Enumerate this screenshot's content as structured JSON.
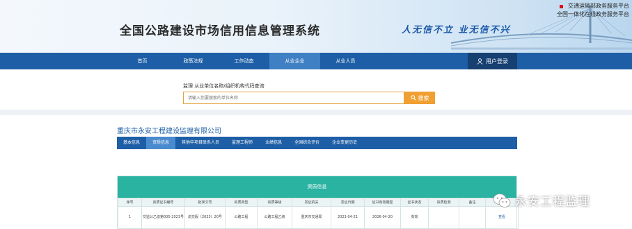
{
  "header": {
    "site_title": "全国公路建设市场信用信息管理系统",
    "slogan": "人无信不立 业无信不兴",
    "top_links": [
      "交通运输部政务服务平台",
      "全国一体化在线政务服务平台"
    ]
  },
  "nav": {
    "items": [
      {
        "label": "首页"
      },
      {
        "label": "政策法规"
      },
      {
        "label": "工作动态"
      },
      {
        "label": "从业企业"
      },
      {
        "label": "从业人员"
      }
    ],
    "active_index": 3,
    "login_label": "用户登录"
  },
  "search": {
    "label": "监理 从业单位名称/组织机构代码查询",
    "placeholder": "请输入您要搜索的单位名称",
    "button_label": "搜索"
  },
  "company": {
    "name": "重庆市永安工程建设监理有限公司",
    "tabs": [
      {
        "label": "基本信息"
      },
      {
        "label": "资质信息"
      },
      {
        "label": "其他中项目联系人员"
      },
      {
        "label": "监理工程师"
      },
      {
        "label": "业绩信息"
      },
      {
        "label": "全国综合评价"
      },
      {
        "label": "企业变更历史"
      }
    ],
    "active_tab": 1
  },
  "qualification": {
    "title": "资质信息",
    "columns": [
      "序号",
      "资质证书编号",
      "批准文号",
      "资质类型",
      "资质等级",
      "发证机关",
      "发证日期",
      "证书有效期至",
      "证书状态",
      "资质检测",
      "备注",
      ""
    ],
    "rows": [
      {
        "index": "1",
        "cert_no": "交监公乙渝第005-2023号",
        "approval_no": "渝交服〔2023〕20号",
        "type": "公路工程",
        "level": "公路工程乙级",
        "issuer": "重庆市交通局",
        "issue_date": "2023-04-21",
        "valid_until": "2026-04-20",
        "status": "有效",
        "check": "",
        "remark": "",
        "action": "查看"
      }
    ]
  },
  "watermark": {
    "text": "永安工程监理"
  },
  "colors": {
    "nav_blue": "#1d5ea6",
    "accent_orange": "#f0a032",
    "teal": "#2bb3a2",
    "slogan_blue": "#1b58a8"
  }
}
